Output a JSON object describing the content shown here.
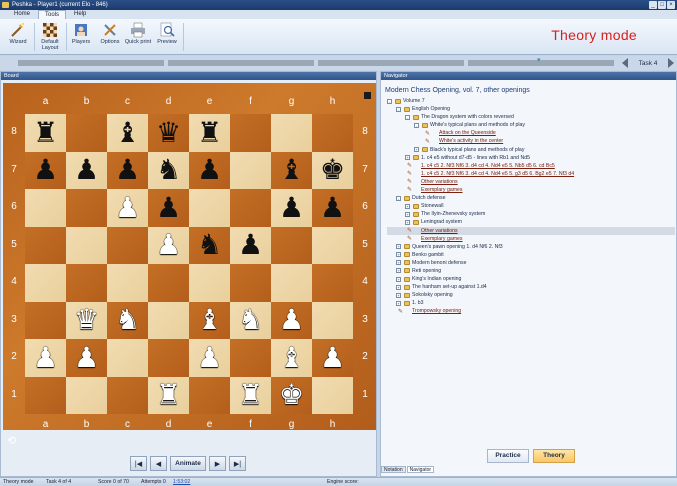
{
  "window": {
    "title": "Peshka - Player1 (current Elo - 846)"
  },
  "ribbon": {
    "tabs": [
      "Home",
      "Tools",
      "Help"
    ],
    "active_tab": "Tools",
    "buttons": [
      "Wizard",
      "Default Layout",
      "Players",
      "Options",
      "Quick print",
      "Preview"
    ],
    "mode_label": "Theory mode"
  },
  "task_nav": {
    "label": "Task 4"
  },
  "board": {
    "panel_title": "Board",
    "files": [
      "a",
      "b",
      "c",
      "d",
      "e",
      "f",
      "g",
      "h"
    ],
    "ranks": [
      "8",
      "7",
      "6",
      "5",
      "4",
      "3",
      "2",
      "1"
    ],
    "rows": [
      [
        "br",
        "",
        "bb",
        "bq",
        "br",
        "",
        "",
        ""
      ],
      [
        "bp",
        "bp",
        "bp",
        "bn",
        "bp",
        "",
        "bb",
        "bk"
      ],
      [
        "",
        "",
        "wp",
        "bp",
        "",
        "",
        "bp",
        "bp"
      ],
      [
        "",
        "",
        "",
        "wp",
        "bn",
        "bp",
        "",
        ""
      ],
      [
        "",
        "",
        "",
        "",
        "",
        "",
        "",
        ""
      ],
      [
        "",
        "wq",
        "wn",
        "",
        "wb",
        "wn",
        "wp",
        ""
      ],
      [
        "wp",
        "wp",
        "",
        "",
        "wp",
        "",
        "wb",
        "wp"
      ],
      [
        "",
        "",
        "",
        "wr",
        "",
        "wr",
        "wk",
        ""
      ]
    ],
    "nav": {
      "animate_label": "Animate"
    }
  },
  "navigator": {
    "panel_title": "Navigator",
    "heading": "Modern Chess Opening, vol. 7, other openings",
    "nodes": [
      {
        "depth": 0,
        "kind": "folder",
        "exp": "-",
        "text": "Volume 7"
      },
      {
        "depth": 1,
        "kind": "folder",
        "exp": "-",
        "text": "English Opening"
      },
      {
        "depth": 2,
        "kind": "folder",
        "exp": "-",
        "text": "The Dragon system with colors reversed"
      },
      {
        "depth": 3,
        "kind": "folder",
        "exp": "-",
        "text": "White's typical plans and methods of play"
      },
      {
        "depth": 4,
        "kind": "line",
        "text": "Attack on the Queenside",
        "link": true
      },
      {
        "depth": 4,
        "kind": "line",
        "text": "White's activity in the center",
        "link": true
      },
      {
        "depth": 3,
        "kind": "folder",
        "exp": "+",
        "text": "Black's typical plans and methods of play"
      },
      {
        "depth": 2,
        "kind": "folder",
        "exp": "+",
        "text": "1. c4 e5 without d7-d5 - lines with Rb1 and Nd5"
      },
      {
        "depth": 2,
        "kind": "line",
        "text": "1. c4 c5 2. Nf3 Nf6 3. d4 cd 4. Nd4 e5 5. Nb5 d5 6. cd Bc5",
        "link": true
      },
      {
        "depth": 2,
        "kind": "line",
        "text": "1. c4 c5 2. Nf3 Nf6 3. d4 cd 4. Nd4 e5 5. g3 d5 6. Bg2 e5 7. Nf3 d4",
        "link": true
      },
      {
        "depth": 2,
        "kind": "line",
        "text": "Other variations",
        "link": true
      },
      {
        "depth": 2,
        "kind": "line",
        "text": "Exemplary games",
        "link": true
      },
      {
        "depth": 1,
        "kind": "folder",
        "exp": "-",
        "text": "Dutch defense"
      },
      {
        "depth": 2,
        "kind": "folder",
        "exp": "+",
        "text": "Stonewall"
      },
      {
        "depth": 2,
        "kind": "folder",
        "exp": "+",
        "text": "The Ilyin-Zhenevsky system"
      },
      {
        "depth": 2,
        "kind": "folder",
        "exp": "+",
        "text": "Leningrad system"
      },
      {
        "depth": 2,
        "kind": "line",
        "text": "Other variations",
        "link": true,
        "selected": true
      },
      {
        "depth": 2,
        "kind": "line",
        "text": "Exemplary games",
        "link": true
      },
      {
        "depth": 1,
        "kind": "folder",
        "exp": "+",
        "text": "Queen's pawn opening 1. d4 Nf6 2. Nf3"
      },
      {
        "depth": 1,
        "kind": "folder",
        "exp": "+",
        "text": "Benko gambit"
      },
      {
        "depth": 1,
        "kind": "folder",
        "exp": "+",
        "text": "Modern benoni defense"
      },
      {
        "depth": 1,
        "kind": "folder",
        "exp": "+",
        "text": "Reti opening"
      },
      {
        "depth": 1,
        "kind": "folder",
        "exp": "+",
        "text": "King's Indian opening"
      },
      {
        "depth": 1,
        "kind": "folder",
        "exp": "+",
        "text": "The hanham set-up against 1.d4"
      },
      {
        "depth": 1,
        "kind": "folder",
        "exp": "+",
        "text": "Sokolsky opening"
      },
      {
        "depth": 1,
        "kind": "folder",
        "exp": "+",
        "text": "1. b3"
      },
      {
        "depth": 1,
        "kind": "line",
        "text": "Trompowsky opening",
        "link": true
      }
    ],
    "practice_label": "Practice",
    "theory_label": "Theory",
    "bottom_tabs": [
      "Notation",
      "Navigator"
    ]
  },
  "status": {
    "mode": "Theory mode",
    "task": "Task 4 of 4",
    "score": "Score 0 of 70",
    "attempts": "Attempts 0",
    "time": "1:53:02",
    "engine": "Engine score:"
  },
  "colors": {
    "mode_label": "#d62020",
    "board_dark": "#b35f1c",
    "board_light": "#f1dcb1"
  }
}
